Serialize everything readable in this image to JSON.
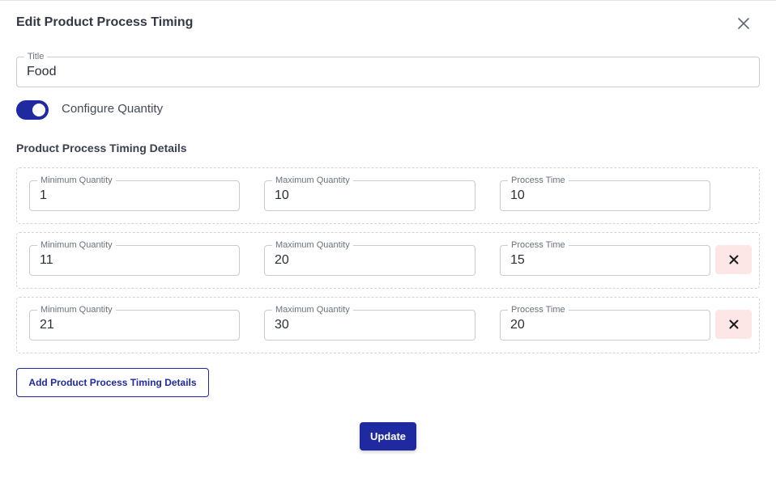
{
  "dialog": {
    "title": "Edit Product Process Timing",
    "close_icon": "close-icon"
  },
  "title_field": {
    "label": "Title",
    "value": "Food"
  },
  "configure_toggle": {
    "label": "Configure Quantity",
    "checked": true
  },
  "section": {
    "title": "Product Process Timing Details"
  },
  "timing_rows": [
    {
      "min_label": "Minimum Quantity",
      "min_value": "1",
      "max_label": "Maximum Quantity",
      "max_value": "10",
      "time_label": "Process Time",
      "time_value": "10",
      "removable": false
    },
    {
      "min_label": "Minimum Quantity",
      "min_value": "11",
      "max_label": "Maximum Quantity",
      "max_value": "20",
      "time_label": "Process Time",
      "time_value": "15",
      "removable": true
    },
    {
      "min_label": "Minimum Quantity",
      "min_value": "21",
      "max_label": "Maximum Quantity",
      "max_value": "30",
      "time_label": "Process Time",
      "time_value": "20",
      "removable": true
    }
  ],
  "actions": {
    "add_label": "Add Product Process Timing Details",
    "update_label": "Update"
  },
  "colors": {
    "primary": "#1f2aa0",
    "remove_bg": "#fde6e6"
  }
}
